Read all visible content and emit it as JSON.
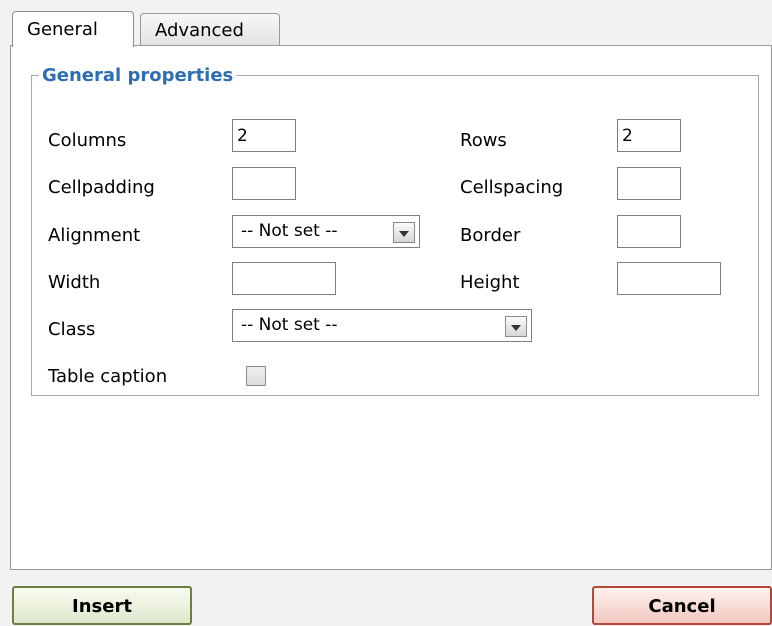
{
  "tabs": [
    {
      "label": "General",
      "active": true
    },
    {
      "label": "Advanced",
      "active": false
    }
  ],
  "general_properties": {
    "legend": "General properties",
    "columns": {
      "label": "Columns",
      "value": "2"
    },
    "rows": {
      "label": "Rows",
      "value": "2"
    },
    "cellpadding": {
      "label": "Cellpadding",
      "value": ""
    },
    "cellspacing": {
      "label": "Cellspacing",
      "value": ""
    },
    "alignment": {
      "label": "Alignment",
      "value": "-- Not set --"
    },
    "border": {
      "label": "Border",
      "value": ""
    },
    "width": {
      "label": "Width",
      "value": ""
    },
    "height": {
      "label": "Height",
      "value": ""
    },
    "class": {
      "label": "Class",
      "value": "-- Not set --"
    },
    "table_caption": {
      "label": "Table caption",
      "checked": false
    }
  },
  "buttons": {
    "insert": "Insert",
    "cancel": "Cancel"
  },
  "icons": {
    "dropdown": "chevron-down-icon",
    "checkbox": "checkbox-unchecked-icon"
  }
}
